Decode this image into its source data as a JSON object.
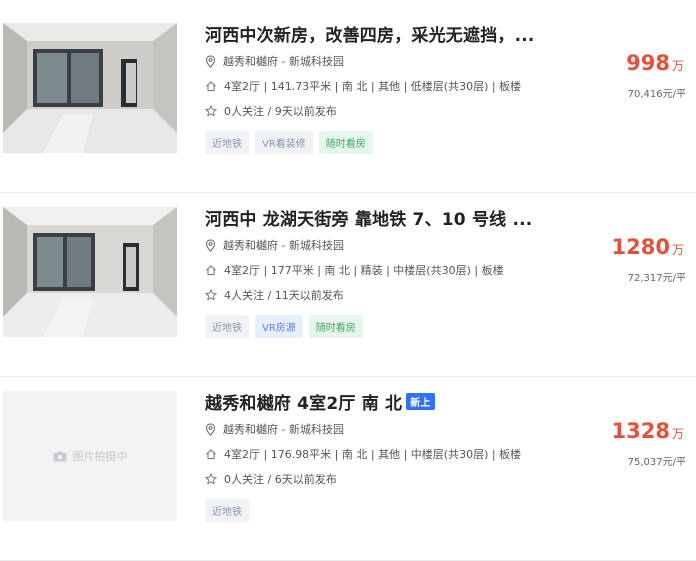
{
  "listings": [
    {
      "title": "河西中次新房，改善四房，采光无遮挡，...",
      "badge": "",
      "community": "越秀和樾府 - 新城科技园",
      "info": "4室2厅 | 141.73平米 | 南 北 | 其他 | 低楼层(共30层) | 板楼",
      "follow": "0人关注 / 9天以前发布",
      "tags": [
        {
          "label": "近地铁",
          "style": "gray"
        },
        {
          "label": "VR看装修",
          "style": "gray"
        },
        {
          "label": "随时看房",
          "style": "green"
        }
      ],
      "price": "998",
      "price_unit": "万",
      "unit_price": "70,416元/平",
      "image": "photo"
    },
    {
      "title": "河西中 龙湖天街旁 靠地铁 7、10 号线 ...",
      "badge": "",
      "community": "越秀和樾府 - 新城科技园",
      "info": "4室2厅 | 177平米 | 南 北 | 精装 | 中楼层(共30层) | 板楼",
      "follow": "4人关注 / 11天以前发布",
      "tags": [
        {
          "label": "近地铁",
          "style": "gray"
        },
        {
          "label": "VR房源",
          "style": "blue"
        },
        {
          "label": "随时看房",
          "style": "green"
        }
      ],
      "price": "1280",
      "price_unit": "万",
      "unit_price": "72,317元/平",
      "image": "photo"
    },
    {
      "title": "越秀和樾府 4室2厅 南 北",
      "badge": "新上",
      "community": "越秀和樾府 - 新城科技园",
      "info": "4室2厅 | 176.98平米 | 南 北 | 其他 | 中楼层(共30层) | 板楼",
      "follow": "0人关注 / 6天以前发布",
      "tags": [
        {
          "label": "近地铁",
          "style": "gray"
        }
      ],
      "price": "1328",
      "price_unit": "万",
      "unit_price": "75,037元/平",
      "image": "placeholder",
      "placeholder_text": "图片拍摄中"
    }
  ],
  "icons": {
    "location": "location-pin-icon",
    "house": "house-icon",
    "star": "star-icon",
    "camera": "camera-icon"
  },
  "colors": {
    "price": "#e3513b",
    "badge": "#3072f6"
  }
}
